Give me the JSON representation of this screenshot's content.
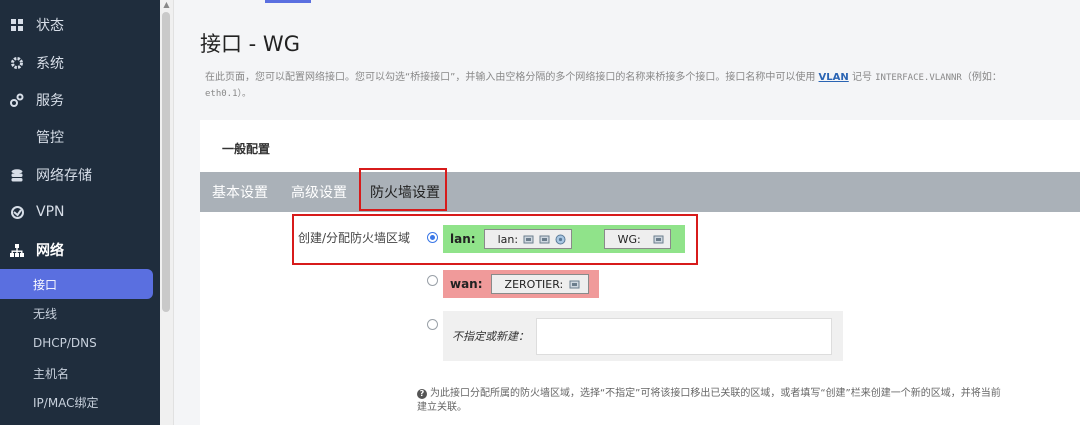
{
  "sidebar": {
    "items": [
      {
        "label": "状态",
        "icon": "dashboard-icon"
      },
      {
        "label": "系统",
        "icon": "gear-icon"
      },
      {
        "label": "服务",
        "icon": "services-icon"
      },
      {
        "label": "管控",
        "icon": ""
      },
      {
        "label": "网络存储",
        "icon": "storage-icon"
      },
      {
        "label": "VPN",
        "icon": "vpn-icon"
      },
      {
        "label": "网络",
        "icon": "network-icon"
      }
    ],
    "subitems": [
      {
        "label": "接口",
        "active": true
      },
      {
        "label": "无线"
      },
      {
        "label": "DHCP/DNS"
      },
      {
        "label": "主机名"
      },
      {
        "label": "IP/MAC绑定"
      }
    ]
  },
  "page": {
    "title": "接口 - WG",
    "desc_part1": "在此页面，您可以配置网络接口。您可以勾选“桥接接口”，并输入由空格分隔的多个网络接口的名称来桥接多个接口。接口名称中可以使用 ",
    "desc_link": "VLAN",
    "desc_part2": " 记号 ",
    "desc_mono": "INTERFACE.VLANNR",
    "desc_part3": "（例如：",
    "desc_line2": "eth0.1）。"
  },
  "section": {
    "title": "一般配置",
    "tabs": [
      "基本设置",
      "高级设置",
      "防火墙设置"
    ]
  },
  "firewall": {
    "label": "创建/分配防火墙区域",
    "zones": [
      {
        "name": "lan:",
        "color": "#90e38a",
        "selected": true,
        "ifaces": [
          {
            "name": "lan:",
            "icons": [
              "ethernet-icon",
              "ethernet-icon",
              "wifi-icon"
            ]
          },
          {
            "name": "WG:",
            "icons": [
              "ethernet-icon"
            ]
          }
        ]
      },
      {
        "name": "wan:",
        "color": "#f09a9a",
        "selected": false,
        "ifaces": [
          {
            "name": "ZEROTIER:",
            "icons": [
              "ethernet-icon"
            ]
          }
        ]
      }
    ],
    "new_label": "不指定或新建："
  },
  "help": {
    "line1": "为此接口分配所属的防火墙区域，选择“不指定”可将该接口移出已关联的区域，或者填写“创建”栏来创建一个新的区域，并将当前",
    "line2": "建立关联。"
  }
}
